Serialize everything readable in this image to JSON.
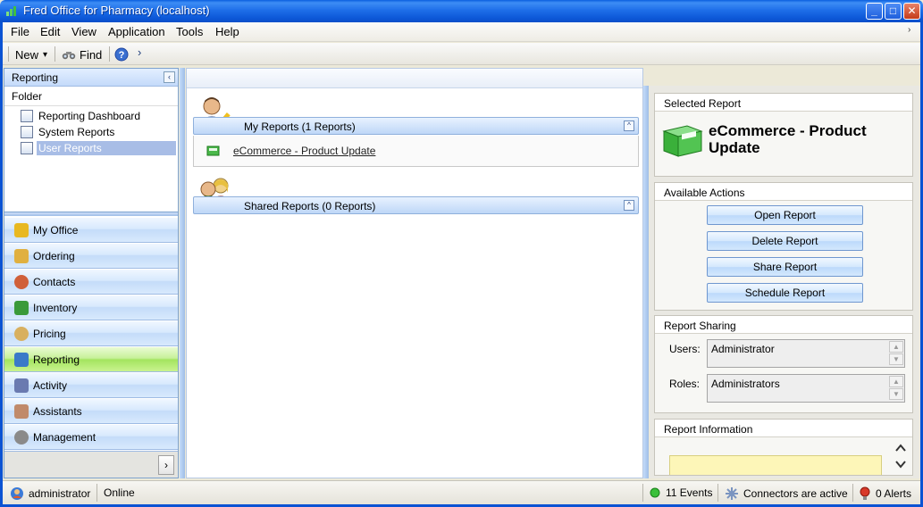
{
  "window": {
    "title": "Fred Office for Pharmacy (localhost)",
    "controls": {
      "minimize": "_",
      "maximize": "□",
      "close": "✕"
    }
  },
  "menubar": {
    "items": [
      {
        "label": "File"
      },
      {
        "label": "Edit"
      },
      {
        "label": "View"
      },
      {
        "label": "Application"
      },
      {
        "label": "Tools"
      },
      {
        "label": "Help"
      }
    ],
    "overflow": "›"
  },
  "toolbar": {
    "new_label": "New",
    "new_dropdown": "▾",
    "find_label": "Find",
    "overflow": "›"
  },
  "left_panel": {
    "header": "Reporting",
    "collapse_glyph": "‹",
    "folder_label": "Folder",
    "tree": [
      {
        "label": "Reporting Dashboard",
        "selected": false
      },
      {
        "label": "System Reports",
        "selected": false
      },
      {
        "label": "User Reports",
        "selected": true
      }
    ],
    "nav": [
      {
        "label": "My Office",
        "icon": "office-icon",
        "color": "#e8b820",
        "active": false
      },
      {
        "label": "Ordering",
        "icon": "ordering-icon",
        "color": "#e0b040",
        "active": false
      },
      {
        "label": "Contacts",
        "icon": "contacts-icon",
        "color": "#d0603a",
        "active": false
      },
      {
        "label": "Inventory",
        "icon": "inventory-icon",
        "color": "#3a9a3a",
        "active": false
      },
      {
        "label": "Pricing",
        "icon": "pricing-icon",
        "color": "#d8b060",
        "active": false
      },
      {
        "label": "Reporting",
        "icon": "reporting-icon",
        "color": "#3a7ac8",
        "active": true
      },
      {
        "label": "Activity",
        "icon": "activity-icon",
        "color": "#6a7ab0",
        "active": false
      },
      {
        "label": "Assistants",
        "icon": "assistants-icon",
        "color": "#c08a6a",
        "active": false
      },
      {
        "label": "Management",
        "icon": "management-icon",
        "color": "#8a8a8a",
        "active": false
      }
    ],
    "more_glyph": "›"
  },
  "center": {
    "groups": [
      {
        "title": "My Reports (1 Reports)",
        "icon": "user-edit-icon",
        "toggle": "^",
        "items": [
          {
            "label": "eCommerce - Product Update"
          }
        ]
      },
      {
        "title": "Shared Reports (0 Reports)",
        "icon": "users-share-icon",
        "toggle": "^",
        "items": []
      }
    ]
  },
  "right_panel": {
    "selected_report": {
      "title": "Selected Report",
      "name": "eCommerce - Product Update"
    },
    "available_actions": {
      "title": "Available Actions",
      "buttons": [
        "Open Report",
        "Delete Report",
        "Share Report",
        "Schedule Report"
      ]
    },
    "report_sharing": {
      "title": "Report Sharing",
      "users_label": "Users:",
      "users_value": "Administrator",
      "roles_label": "Roles:",
      "roles_value": "Administrators"
    },
    "report_information": {
      "title": "Report Information"
    }
  },
  "statusbar": {
    "user": "administrator",
    "connection": "Online",
    "events": "11 Events",
    "connectors": "Connectors are active",
    "alerts": "0 Alerts"
  },
  "colors": {
    "titlebar": "#0a5fe0",
    "accent": "#7da2ce",
    "active_nav": "#a4e45f",
    "selection": "#a8bde6"
  }
}
